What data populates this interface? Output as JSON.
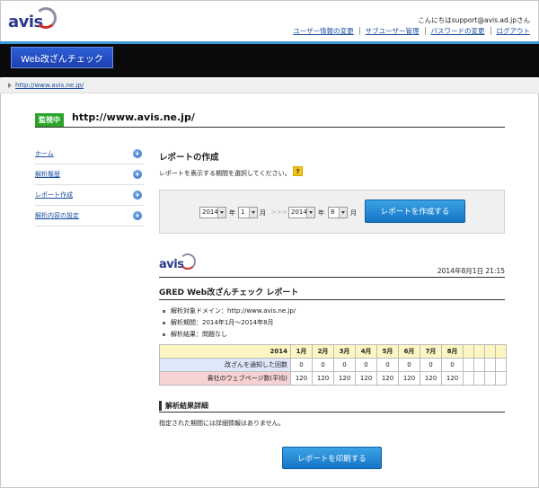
{
  "header": {
    "logo_text": "avis",
    "greeting": "こんにちはsupport@avis.ad.jpさん",
    "links": [
      "ユーザー情報の変更",
      "サブユーザー管理",
      "パスワードの変更",
      "ログアウト"
    ],
    "app_tab": "Web改ざんチェック",
    "breadcrumb": "http://www.avis.ne.jp/"
  },
  "site": {
    "badge": "監視中",
    "url": "http://www.avis.ne.jp/"
  },
  "sidebar": {
    "items": [
      {
        "label": "ホーム"
      },
      {
        "label": "解析履歴"
      },
      {
        "label": "レポート作成"
      },
      {
        "label": "解析内容の設定"
      }
    ]
  },
  "report_form": {
    "title": "レポートの作成",
    "instruction": "レポートを表示する期間を選択してください。",
    "help": "?",
    "from_year": "2014",
    "from_month": "1",
    "to_year": "2014",
    "to_month": "8",
    "year_unit": "年",
    "month_unit": "月",
    "arrows": "> > >",
    "create_button": "レポートを作成する"
  },
  "report": {
    "logo_text": "avis",
    "date": "2014年8月1日 21:15",
    "title": "GRED Web改ざんチェック レポート",
    "bullets": [
      "解析対象ドメイン：http://www.avis.ne.jp/",
      "解析期間：2014年1月～2014年8月",
      "解析結果：問題なし"
    ],
    "table": {
      "year": "2014",
      "months": [
        "1月",
        "2月",
        "3月",
        "4月",
        "5月",
        "6月",
        "7月",
        "8月"
      ],
      "rows": [
        {
          "label": "改ざんを通知した回数",
          "values": [
            "0",
            "0",
            "0",
            "0",
            "0",
            "0",
            "0",
            "0"
          ]
        },
        {
          "label": "貴社のウェブページ数(平均)",
          "values": [
            "120",
            "120",
            "120",
            "120",
            "120",
            "120",
            "120",
            "120"
          ]
        }
      ]
    },
    "detail_heading": "解析結果詳細",
    "detail_text": "指定された期間には詳細情報はありません。",
    "print_button": "レポートを印刷する"
  }
}
